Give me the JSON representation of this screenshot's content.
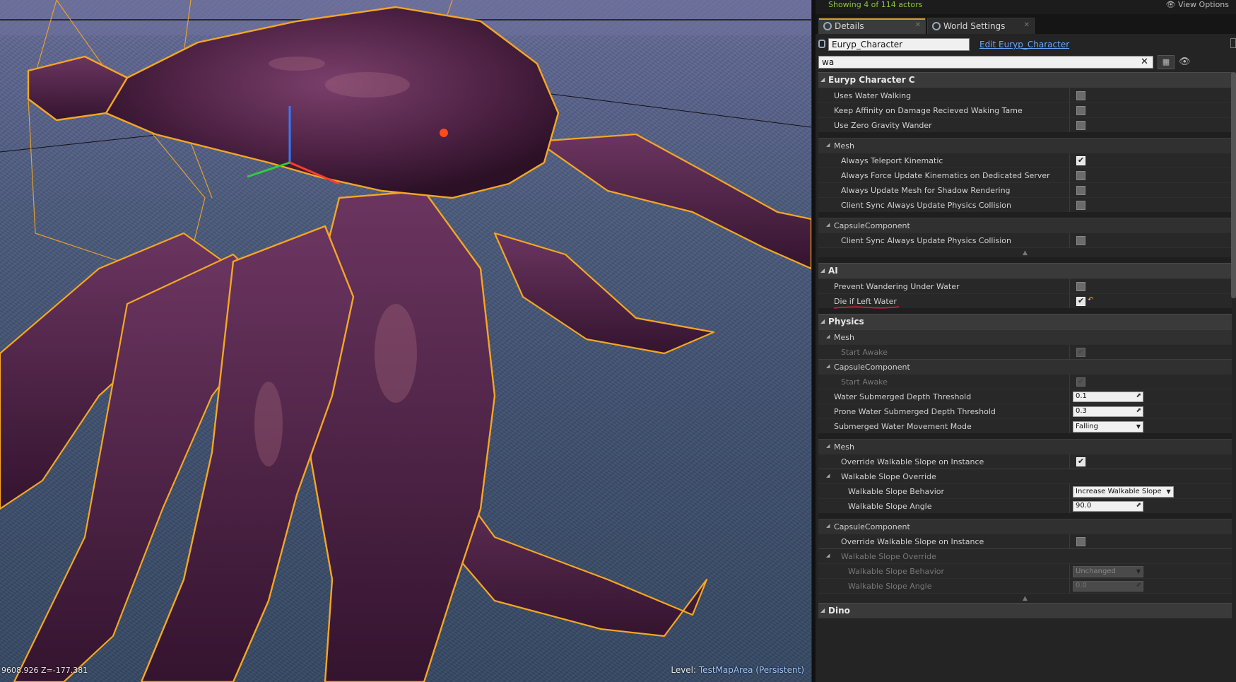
{
  "outliner": {
    "showing": "Showing 4 of 114 actors",
    "view_options": "View Options"
  },
  "tabs": [
    {
      "label": "Details",
      "icon": "magnifier-icon"
    },
    {
      "label": "World Settings",
      "icon": "globe-icon"
    }
  ],
  "actor": {
    "name": "Euryp_Character",
    "edit_link": "Edit Euryp_Character"
  },
  "search": {
    "value": "wa",
    "clear": "✕"
  },
  "viewport": {
    "coords": "9608.926 Z=-177.381",
    "level_label": "Level:",
    "level_name": "TestMapArea (Persistent)"
  },
  "categories": {
    "euryp": {
      "title": "Euryp Character C",
      "uses_water_walking": "Uses Water Walking",
      "keep_affinity": "Keep Affinity on Damage Recieved Waking Tame",
      "zero_gravity": "Use Zero Gravity Wander",
      "mesh": {
        "title": "Mesh",
        "teleport": "Always Teleport Kinematic",
        "force_update": "Always Force Update Kinematics on Dedicated Server",
        "shadow": "Always Update Mesh for Shadow Rendering",
        "client_sync": "Client Sync Always Update Physics Collision"
      },
      "capsule": {
        "title": "CapsuleComponent",
        "client_sync": "Client Sync Always Update Physics Collision"
      }
    },
    "ai": {
      "title": "AI",
      "prevent_wandering": "Prevent Wandering Under Water",
      "die_left_water": "Die if Left Water"
    },
    "physics": {
      "title": "Physics",
      "mesh_title": "Mesh",
      "start_awake": "Start Awake",
      "capsule_title": "CapsuleComponent",
      "capsule_start_awake": "Start Awake",
      "water_depth": "Water Submerged Depth Threshold",
      "water_depth_value": "0.1",
      "prone_depth": "Prone Water Submerged Depth Threshold",
      "prone_depth_value": "0.3",
      "movement_mode": "Submerged Water Movement Mode",
      "movement_mode_value": "Falling"
    },
    "walk_mesh": {
      "title": "Mesh",
      "override": "Override Walkable Slope on Instance",
      "override_group": "Walkable Slope Override",
      "behavior": "Walkable Slope Behavior",
      "behavior_value": "Increase Walkable Slope",
      "angle": "Walkable Slope Angle",
      "angle_value": "90.0"
    },
    "walk_capsule": {
      "title": "CapsuleComponent",
      "override": "Override Walkable Slope on Instance",
      "override_group": "Walkable Slope Override",
      "behavior": "Walkable Slope Behavior",
      "behavior_value": "Unchanged",
      "angle": "Walkable Slope Angle",
      "angle_value": "0.0"
    },
    "dino": {
      "title": "Dino"
    }
  },
  "colors": {
    "accent": "#d39c2a",
    "link": "#6ba7ff",
    "outline": "#f5a623",
    "creature": "#5a2a4e"
  }
}
